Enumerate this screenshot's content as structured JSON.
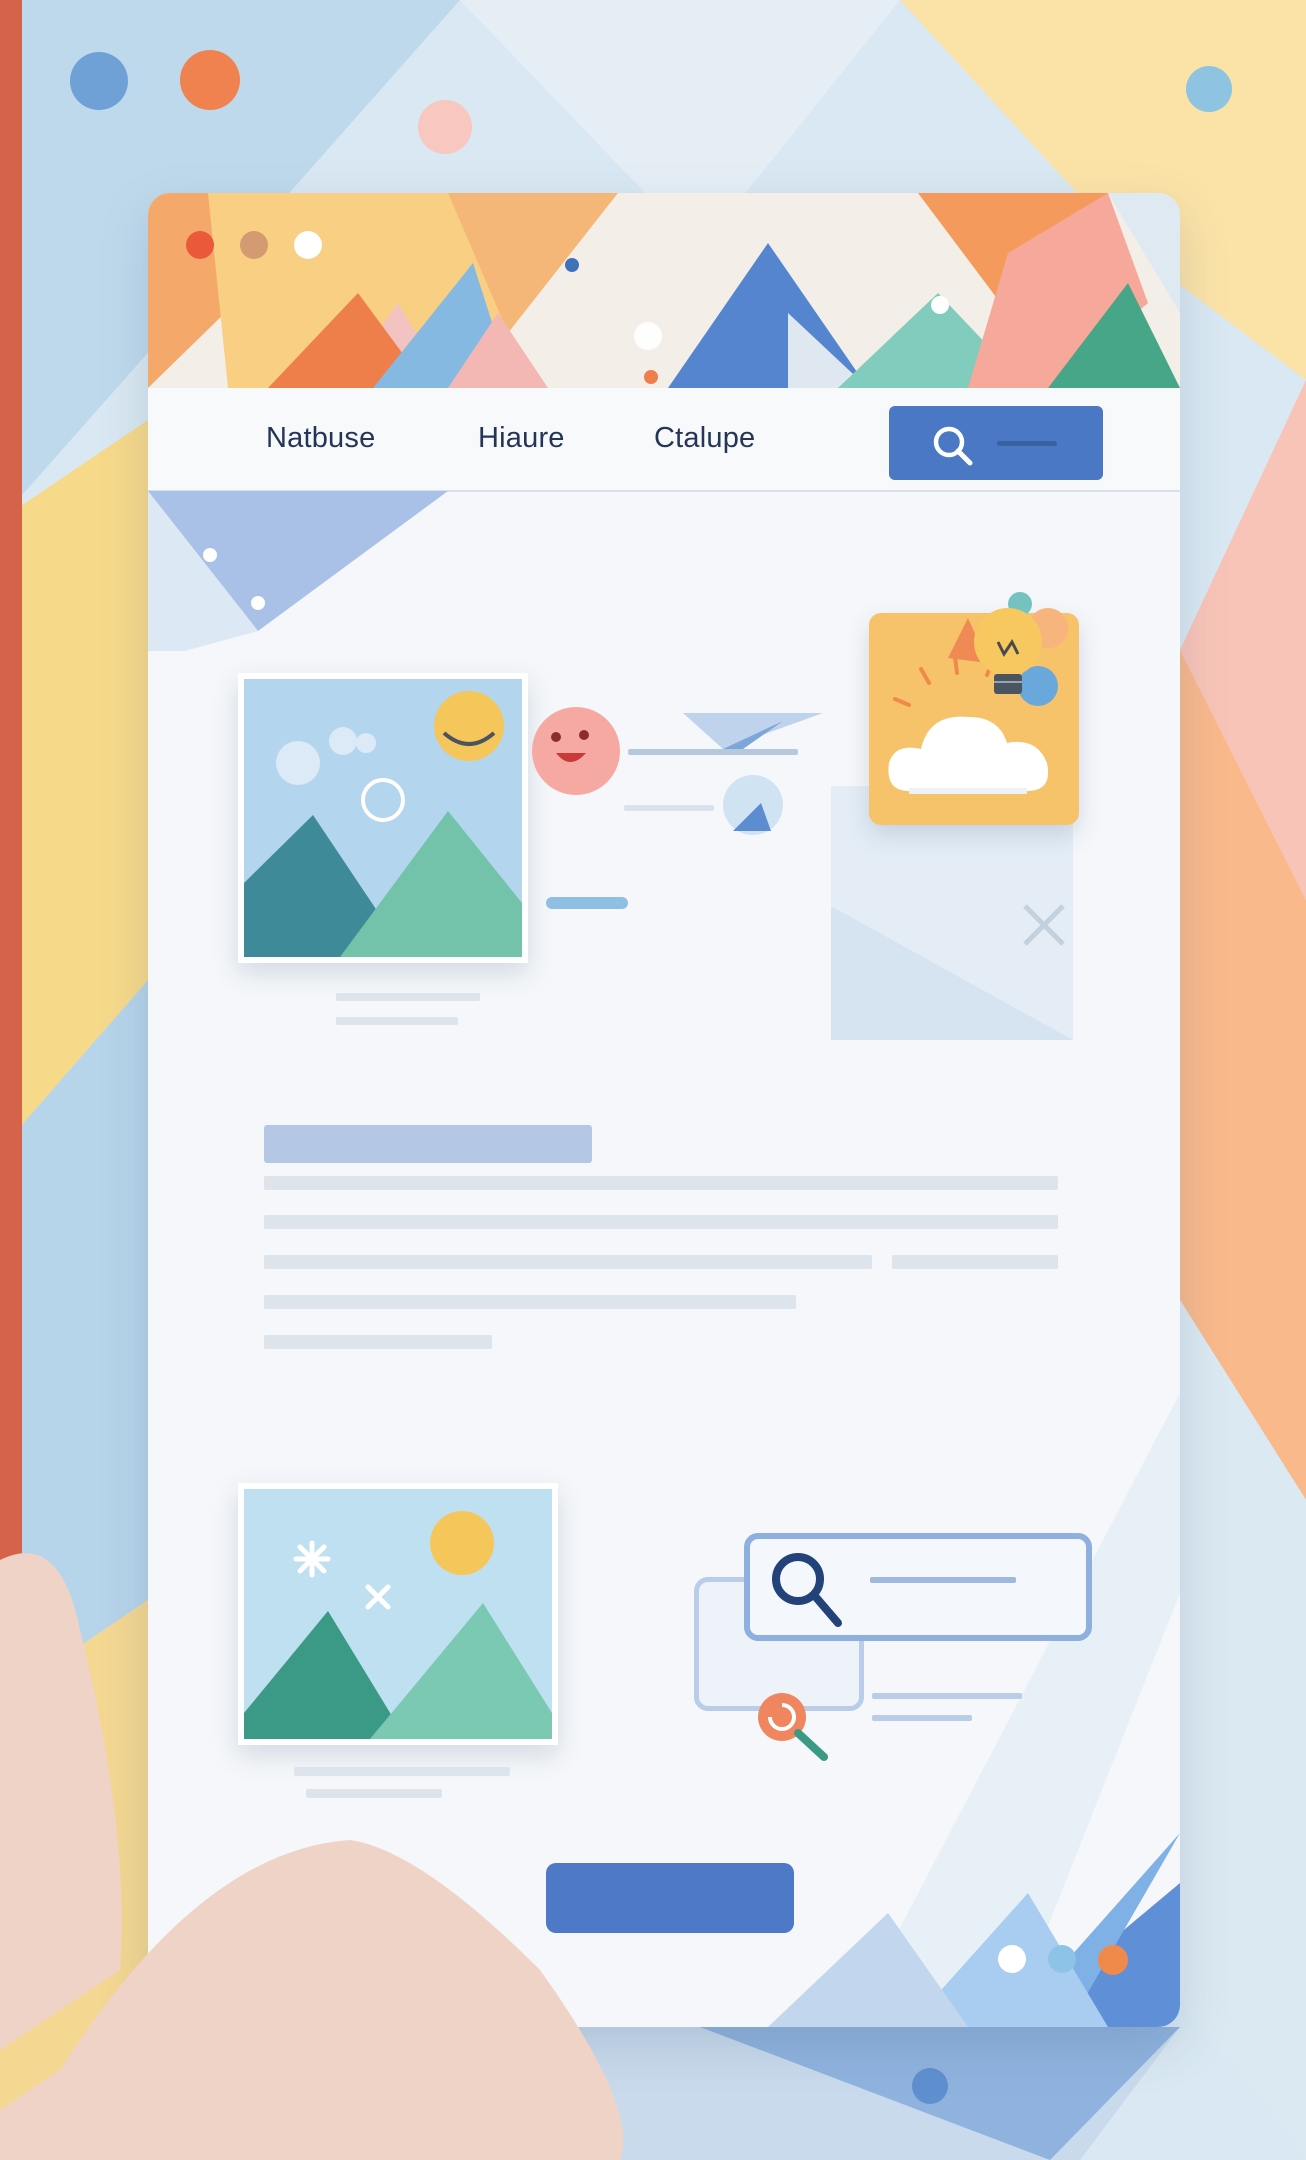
{
  "nav": {
    "links": [
      "Natbuse",
      "Hiaure",
      "Ctalupe"
    ]
  },
  "icons": {
    "search": "search-icon",
    "lightbulb": "lightbulb-icon",
    "cloud": "cloud-icon",
    "close": "close-icon",
    "image": "image-icon",
    "smiley": "smiley-icon",
    "sparkle": "sparkle-icon"
  },
  "colors": {
    "accent_blue": "#4a78c4",
    "accent_orange": "#f08a55",
    "teal": "#4aa58e",
    "yellow": "#f6c85f",
    "page_bg": "#f5f7fa"
  },
  "pagination": {
    "dots": 3,
    "active": 3
  }
}
